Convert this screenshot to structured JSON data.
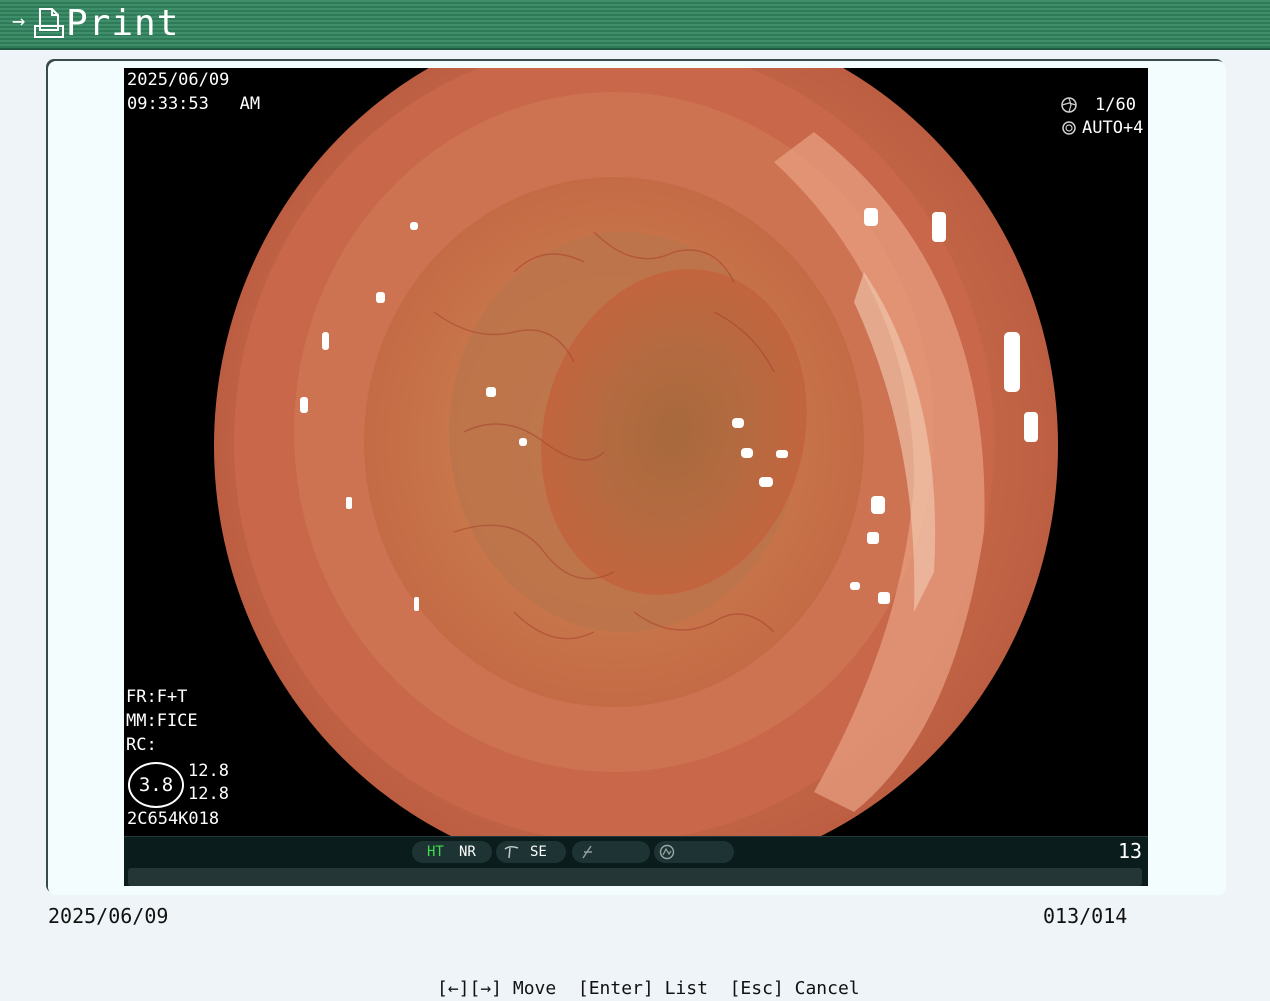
{
  "header": {
    "title": "Print",
    "arrow_glyph": "→",
    "color": "#2f7a58"
  },
  "image": {
    "date": "2025/06/09",
    "time": "09:33:53   AM",
    "shutter": "1/60",
    "exposure": "AUTO+4",
    "fr": "FR:F+T",
    "mm": "MM:FICE",
    "rc": "RC:",
    "circle_value": "3.8",
    "value_a": "12.8",
    "value_b": "12.8",
    "serial": "2C654K018"
  },
  "status_bar": {
    "ht": "HT",
    "nr": "NR",
    "se": "SE",
    "number": "13",
    "ht_color": "#3ddc4a"
  },
  "footer": {
    "date": "2025/06/09",
    "counter": "013/014",
    "hint": "[←][→] Move  [Enter] List  [Esc] Cancel"
  }
}
